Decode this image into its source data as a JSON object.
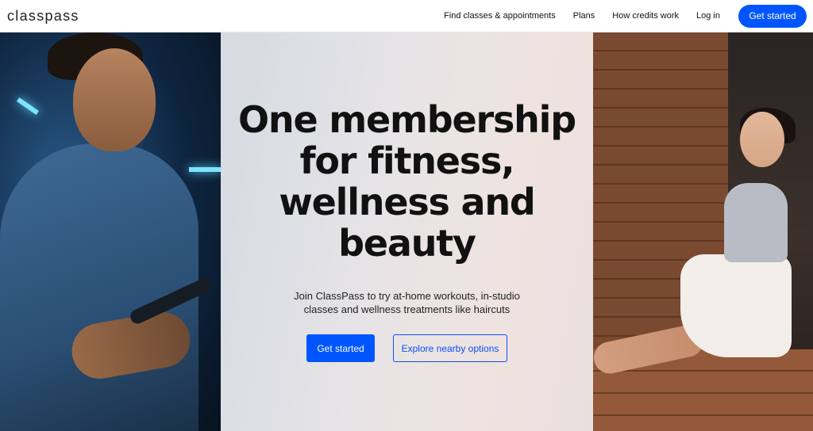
{
  "header": {
    "logo": "classpass",
    "nav": [
      {
        "label": "Find classes & appointments"
      },
      {
        "label": "Plans"
      },
      {
        "label": "How credits work"
      },
      {
        "label": "Log in"
      }
    ],
    "cta_label": "Get started"
  },
  "hero": {
    "headline": "One membership for fitness, wellness and beauty",
    "subtext": "Join ClassPass to try at-home workouts, in-studio classes and wellness treatments like haircuts",
    "primary_cta": "Get started",
    "secondary_cta": "Explore nearby options"
  },
  "colors": {
    "accent": "#0055ff",
    "text": "#111111"
  }
}
